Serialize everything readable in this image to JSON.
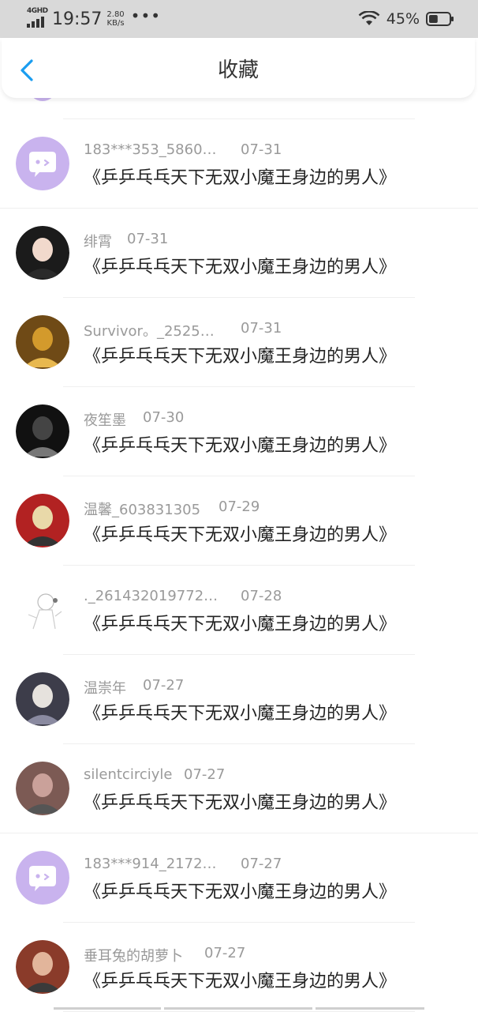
{
  "status_bar": {
    "network": "4GHD",
    "time": "19:57",
    "speed_value": "2.80",
    "speed_unit": "KB/s",
    "more": "•••",
    "battery_percent": "45%",
    "battery_level": 0.45
  },
  "nav": {
    "title": "收藏",
    "back_icon": "chevron-left-icon"
  },
  "items": [
    {
      "name": "183***353_5860…",
      "date": "07-31",
      "content": "《乒乒乓乓天下无双小魔王身边的男人》",
      "avatar": "chat-bubble-avatar"
    },
    {
      "name": "绯霄",
      "date": "07-31",
      "content": "《乒乒乓乓天下无双小魔王身边的男人》",
      "avatar": "photo-avatar"
    },
    {
      "name": "Survivor。_2525…",
      "date": "07-31",
      "content": "《乒乒乓乓天下无双小魔王身边的男人》",
      "avatar": "photo-avatar"
    },
    {
      "name": "夜笙墨",
      "date": "07-30",
      "content": "《乒乒乓乓天下无双小魔王身边的男人》",
      "avatar": "photo-avatar"
    },
    {
      "name": "温馨_603831305",
      "date": "07-29",
      "content": "《乒乒乓乓天下无双小魔王身边的男人》",
      "avatar": "photo-avatar"
    },
    {
      "name": "._261432019772…",
      "date": "07-28",
      "content": "《乒乒乓乓天下无双小魔王身边的男人》",
      "avatar": "sketch-avatar"
    },
    {
      "name": "温崇年",
      "date": "07-27",
      "content": "《乒乒乓乓天下无双小魔王身边的男人》",
      "avatar": "photo-avatar"
    },
    {
      "name": "silentcirciyle",
      "date": "07-27",
      "content": "《乒乒乓乓天下无双小魔王身边的男人》",
      "avatar": "photo-avatar"
    },
    {
      "name": "183***914_2172…",
      "date": "07-27",
      "content": "《乒乒乓乓天下无双小魔王身边的男人》",
      "avatar": "chat-bubble-avatar"
    },
    {
      "name": "垂耳兔的胡萝卜",
      "date": "07-27",
      "content": "《乒乒乓乓天下无双小魔王身边的男人》",
      "avatar": "photo-avatar"
    }
  ],
  "colors": {
    "accent": "#1a9df0",
    "default_avatar": "#c9b3ee",
    "meta_text": "#9a9a9a",
    "status_bar_bg": "#d9d9d9"
  }
}
